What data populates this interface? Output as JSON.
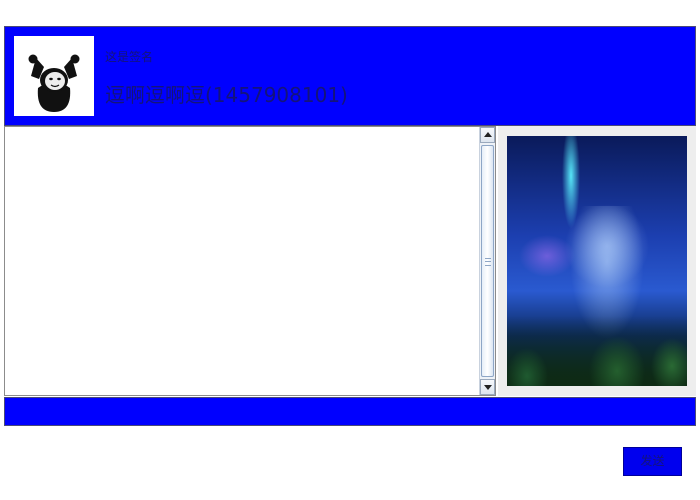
{
  "header": {
    "signature": "这是签名",
    "username": "逗啊逗啊逗(1457908101)",
    "avatar_icon": "panda-meme-avatar-icon",
    "background_color": "#0000ff"
  },
  "chat": {
    "messages": []
  },
  "side_panel": {
    "image_icon": "starry-sky-tree-image"
  },
  "input_bar": {
    "background_color": "#0000ff"
  },
  "actions": {
    "send_label": "发送"
  }
}
